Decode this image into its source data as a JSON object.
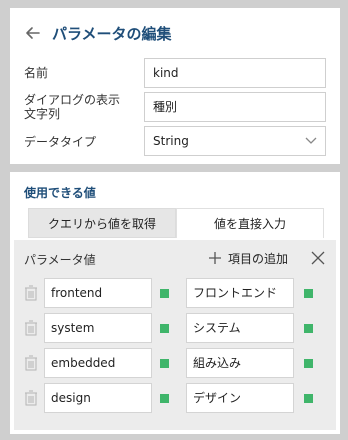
{
  "header": {
    "title": "パラメータの編集",
    "back_icon": "arrow-left-icon"
  },
  "form": {
    "name_label": "名前",
    "name_value": "kind",
    "display_label": "ダイアログの表示\n文字列",
    "display_label_line1": "ダイアログの表示",
    "display_label_line2": "文字列",
    "display_value": "種別",
    "datatype_label": "データタイプ",
    "datatype_value": "String"
  },
  "values_section": {
    "title": "使用できる値",
    "tabs": [
      {
        "label": "クエリから値を取得",
        "active": false
      },
      {
        "label": "値を直接入力",
        "active": true
      }
    ],
    "list_header": "パラメータ値",
    "add_label": "項目の追加",
    "items": [
      {
        "value": "frontend",
        "label": "フロントエンド"
      },
      {
        "value": "system",
        "label": "システム"
      },
      {
        "value": "embedded",
        "label": "組み込み"
      },
      {
        "value": "design",
        "label": "デザイン"
      }
    ]
  },
  "colors": {
    "accent": "#1f4e79",
    "status_green": "#3fb56a",
    "background": "#cfcfcf",
    "list_background": "#ececec"
  }
}
